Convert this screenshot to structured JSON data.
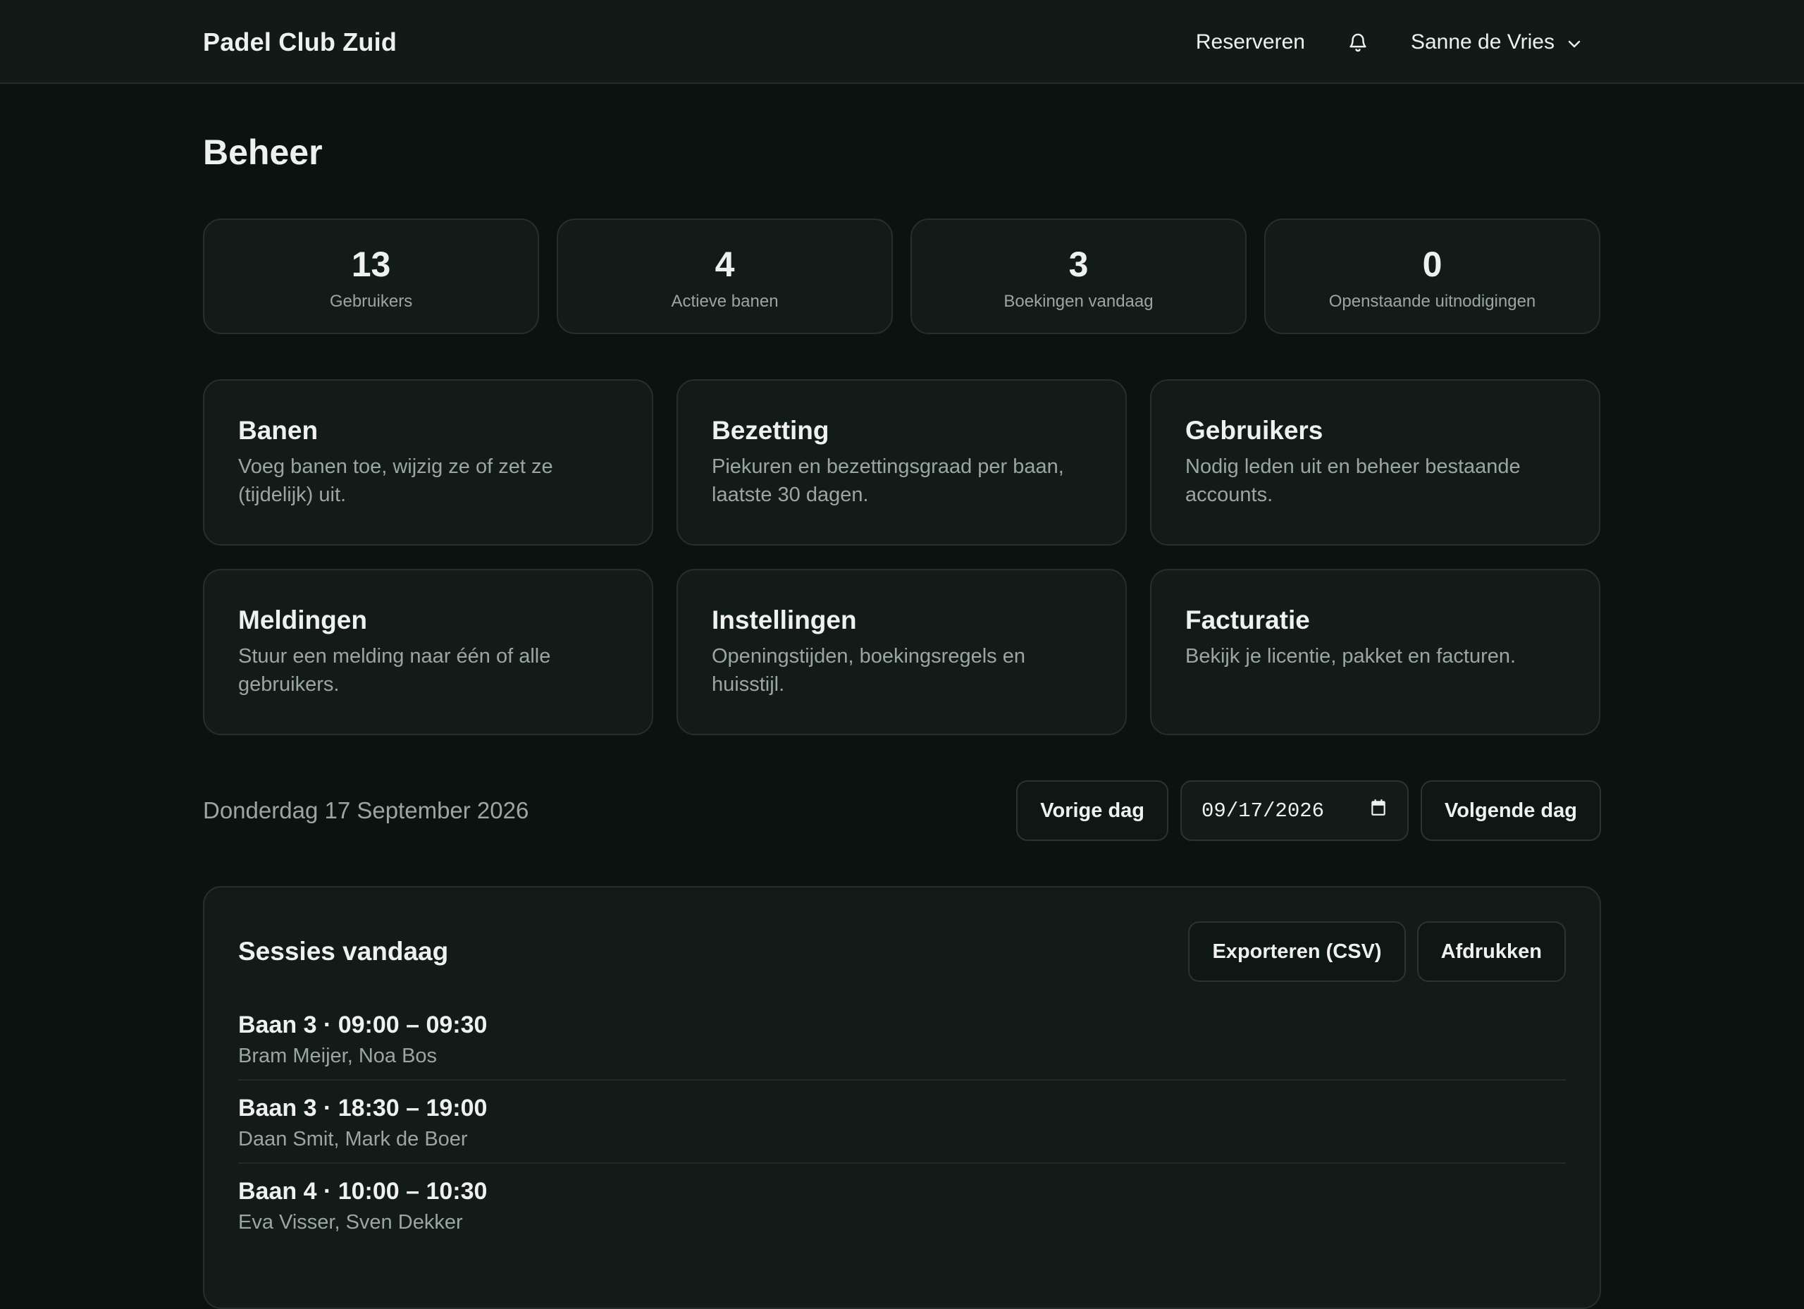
{
  "header": {
    "brand": "Padel Club Zuid",
    "nav_reserve": "Reserveren",
    "notifications_icon": "bell-icon",
    "user_name": "Sanne de Vries",
    "user_menu_icon": "chevron-down-icon"
  },
  "page": {
    "title": "Beheer"
  },
  "stats": [
    {
      "value": "13",
      "label": "Gebruikers"
    },
    {
      "value": "4",
      "label": "Actieve banen"
    },
    {
      "value": "3",
      "label": "Boekingen vandaag"
    },
    {
      "value": "0",
      "label": "Openstaande uitnodigingen"
    }
  ],
  "cards": [
    {
      "title": "Banen",
      "desc": "Voeg banen toe, wijzig ze of zet ze (tijdelijk) uit."
    },
    {
      "title": "Bezetting",
      "desc": "Piekuren en bezettingsgraad per baan, laatste 30 dagen."
    },
    {
      "title": "Gebruikers",
      "desc": "Nodig leden uit en beheer bestaande accounts."
    },
    {
      "title": "Meldingen",
      "desc": "Stuur een melding naar één of alle gebruikers."
    },
    {
      "title": "Instellingen",
      "desc": "Openingstijden, boekingsregels en huisstijl."
    },
    {
      "title": "Facturatie",
      "desc": "Bekijk je licentie, pakket en facturen."
    }
  ],
  "date_nav": {
    "label": "Donderdag 17 September 2026",
    "prev_label": "Vorige dag",
    "date_value": "09/17/2026",
    "calendar_icon": "calendar-icon",
    "next_label": "Volgende dag"
  },
  "sessions": {
    "title": "Sessies vandaag",
    "export_label": "Exporteren (CSV)",
    "print_label": "Afdrukken",
    "items": [
      {
        "time": "Baan 3 · 09:00 – 09:30",
        "players": "Bram Meijer, Noa Bos"
      },
      {
        "time": "Baan 3 · 18:30 – 19:00",
        "players": "Daan Smit, Mark de Boer"
      },
      {
        "time": "Baan 4 · 10:00 – 10:30",
        "players": "Eva Visser, Sven Dekker"
      }
    ]
  }
}
